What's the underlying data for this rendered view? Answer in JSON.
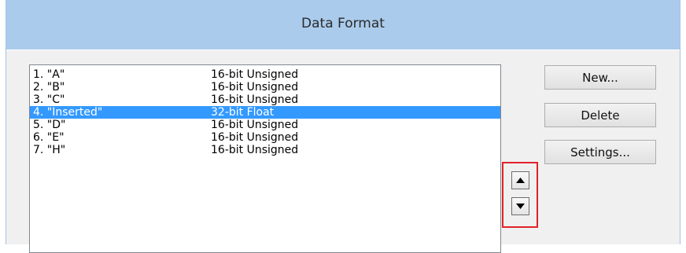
{
  "dialog": {
    "title": "Data Format"
  },
  "list": {
    "items": [
      {
        "name": "1. \"A\"",
        "format": "16-bit Unsigned",
        "selected": false
      },
      {
        "name": "2. \"B\"",
        "format": "16-bit Unsigned",
        "selected": false
      },
      {
        "name": "3. \"C\"",
        "format": "16-bit Unsigned",
        "selected": false
      },
      {
        "name": "4. \"Inserted\"",
        "format": "32-bit Float",
        "selected": true
      },
      {
        "name": "5. \"D\"",
        "format": "16-bit Unsigned",
        "selected": false
      },
      {
        "name": "6. \"E\"",
        "format": "16-bit Unsigned",
        "selected": false
      },
      {
        "name": "7. \"H\"",
        "format": "16-bit Unsigned",
        "selected": false
      }
    ]
  },
  "buttons": {
    "new_label": "New...",
    "delete_label": "Delete",
    "settings_label": "Settings..."
  },
  "reorder": {
    "up_icon": "arrow-up-icon",
    "down_icon": "arrow-down-icon",
    "highlight_color": "#e0222a"
  },
  "colors": {
    "title_bar": "#aacbec",
    "selection": "#3399ff",
    "dialog_bg": "#f0f0f0"
  }
}
